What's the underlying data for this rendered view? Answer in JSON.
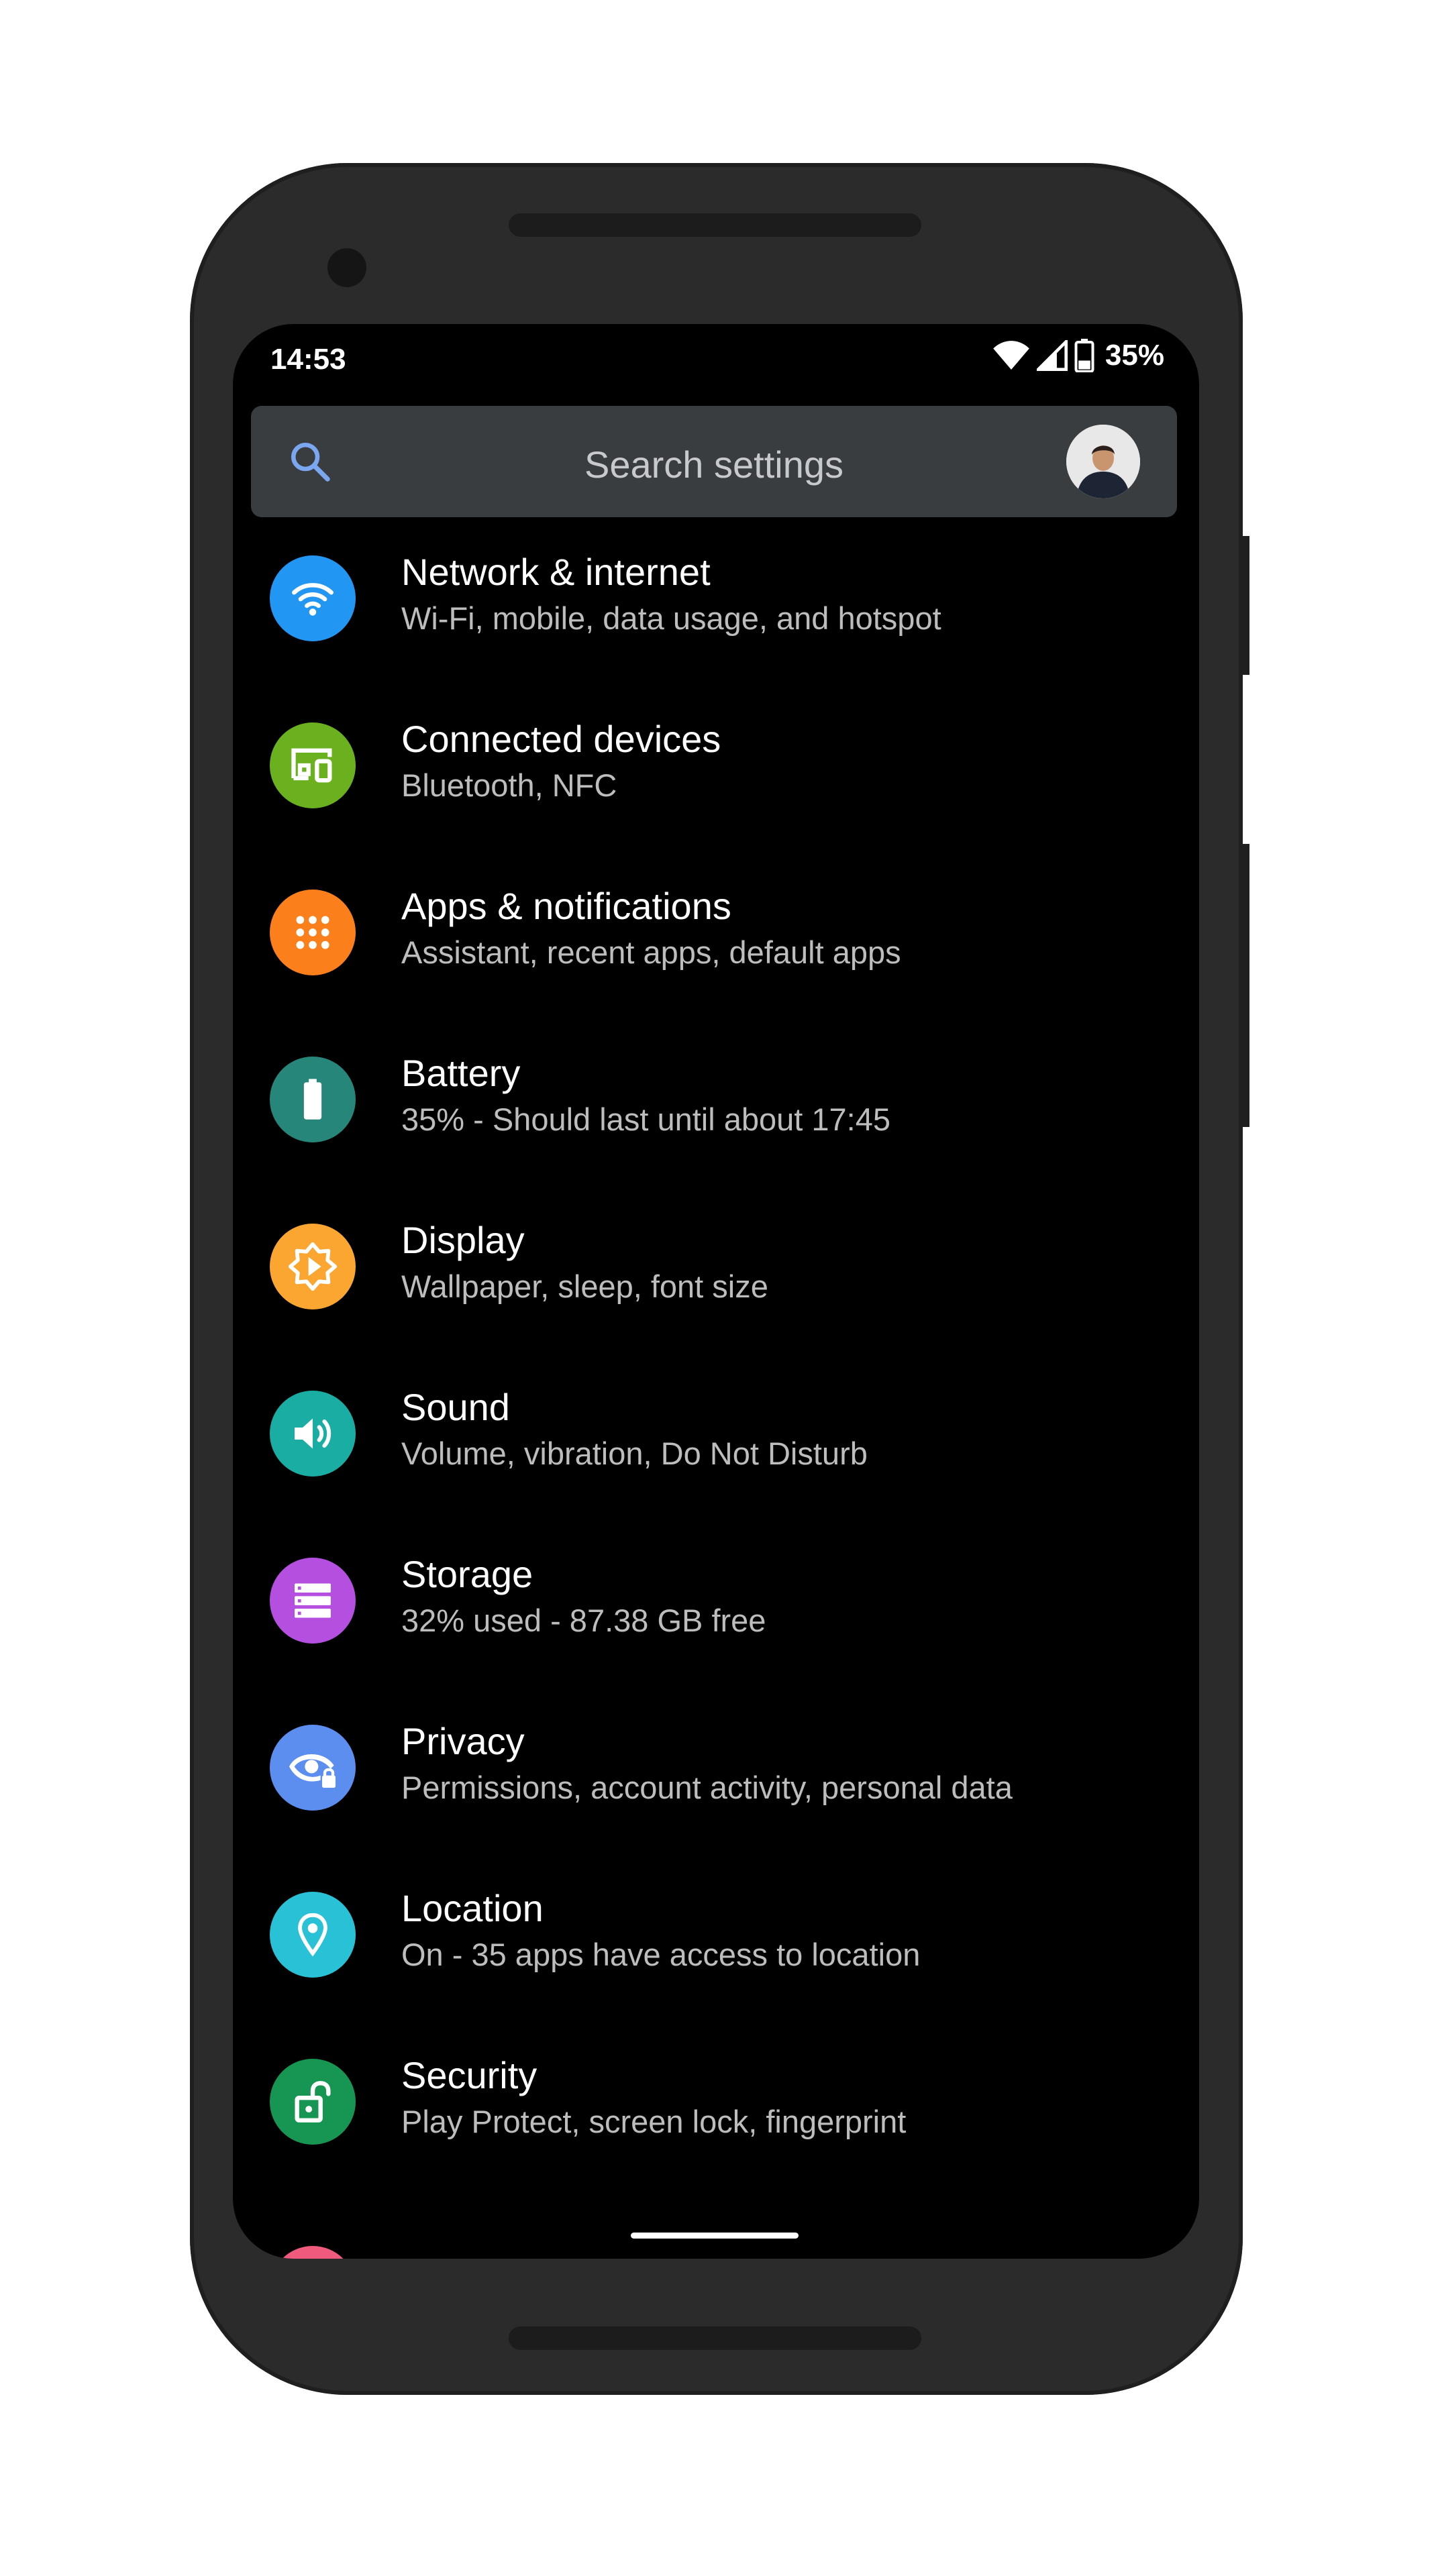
{
  "status_bar": {
    "time": "14:53",
    "battery_percent": "35%",
    "icons": [
      "wifi-icon",
      "signal-icon",
      "battery-icon"
    ]
  },
  "search": {
    "placeholder": "Search settings",
    "icon": "search-icon",
    "accent": "#7aa7ef"
  },
  "settings": {
    "items": [
      {
        "title": "Network & internet",
        "subtitle": "Wi-Fi, mobile, data usage, and hotspot",
        "icon": "wifi-icon",
        "color": "#2196f3"
      },
      {
        "title": "Connected devices",
        "subtitle": "Bluetooth, NFC",
        "icon": "devices-icon",
        "color": "#6bb01f"
      },
      {
        "title": "Apps & notifications",
        "subtitle": "Assistant, recent apps, default apps",
        "icon": "apps-grid-icon",
        "color": "#fb7f1b"
      },
      {
        "title": "Battery",
        "subtitle": "35% - Should last until about 17:45",
        "icon": "battery-icon",
        "color": "#26867a"
      },
      {
        "title": "Display",
        "subtitle": "Wallpaper, sleep, font size",
        "icon": "brightness-icon",
        "color": "#fba630"
      },
      {
        "title": "Sound",
        "subtitle": "Volume, vibration, Do Not Disturb",
        "icon": "volume-icon",
        "color": "#19ada3"
      },
      {
        "title": "Storage",
        "subtitle": "32% used - 87.38 GB free",
        "icon": "storage-icon",
        "color": "#b54fe0"
      },
      {
        "title": "Privacy",
        "subtitle": "Permissions, account activity, personal data",
        "icon": "privacy-eye-icon",
        "color": "#5c8ef0"
      },
      {
        "title": "Location",
        "subtitle": "On - 35 apps have access to location",
        "icon": "location-pin-icon",
        "color": "#29c1d6"
      },
      {
        "title": "Security",
        "subtitle": "Play Protect, screen lock, fingerprint",
        "icon": "lock-open-icon",
        "color": "#169553"
      }
    ],
    "next_item_color": "#ef5a7d"
  }
}
